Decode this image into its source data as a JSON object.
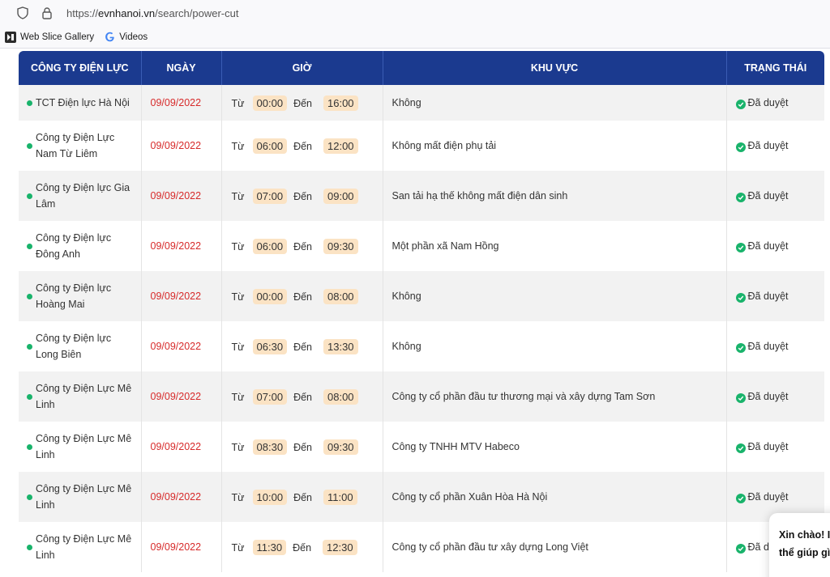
{
  "browser": {
    "url_prefix": "https://",
    "url_domain": "evnhanoi.vn",
    "url_path": "/search/power-cut"
  },
  "bookmarks": [
    {
      "label": "Web Slice Gallery",
      "icon": "web-slice-icon"
    },
    {
      "label": "Videos",
      "icon": "google-g-icon"
    }
  ],
  "table": {
    "headers": [
      "CÔNG TY ĐIỆN LỰC",
      "NGÀY",
      "GIỜ",
      "KHU VỰC",
      "TRẠNG THÁI"
    ],
    "from_label": "Từ",
    "to_label": "Đến",
    "rows": [
      {
        "company": "TCT Điện lực Hà Nội",
        "date": "09/09/2022",
        "from": "00:00",
        "to": "16:00",
        "area": "Không",
        "status": "Đã duyệt"
      },
      {
        "company": "Công ty Điện Lực Nam Từ Liêm",
        "date": "09/09/2022",
        "from": "06:00",
        "to": "12:00",
        "area": "Không mất điện phụ tải",
        "status": "Đã duyệt"
      },
      {
        "company": "Công ty Điện lực Gia Lâm",
        "date": "09/09/2022",
        "from": "07:00",
        "to": "09:00",
        "area": "San tải hạ thế không mất điện dân sinh",
        "status": "Đã duyệt"
      },
      {
        "company": "Công ty Điện lực Đông Anh",
        "date": "09/09/2022",
        "from": "06:00",
        "to": "09:30",
        "area": "Một phần xã Nam Hồng",
        "status": "Đã duyệt"
      },
      {
        "company": "Công ty Điện lực Hoàng Mai",
        "date": "09/09/2022",
        "from": "00:00",
        "to": "08:00",
        "area": "Không",
        "status": "Đã duyệt"
      },
      {
        "company": "Công ty Điện lực Long Biên",
        "date": "09/09/2022",
        "from": "06:30",
        "to": "13:30",
        "area": "Không",
        "status": "Đã duyệt"
      },
      {
        "company": "Công ty Điện Lực Mê Linh",
        "date": "09/09/2022",
        "from": "07:00",
        "to": "08:00",
        "area": "Công ty cổ phần đầu tư thương mại và xây dựng Tam Sơn",
        "status": "Đã duyệt"
      },
      {
        "company": "Công ty Điện Lực Mê Linh",
        "date": "09/09/2022",
        "from": "08:30",
        "to": "09:30",
        "area": "Công ty TNHH MTV Habeco",
        "status": "Đã duyệt"
      },
      {
        "company": "Công ty Điện Lực Mê Linh",
        "date": "09/09/2022",
        "from": "10:00",
        "to": "11:00",
        "area": "Công ty cổ phần Xuân Hòa Hà Nội",
        "status": "Đã duyệt"
      },
      {
        "company": "Công ty Điện Lực Mê Linh",
        "date": "09/09/2022",
        "from": "11:30",
        "to": "12:30",
        "area": "Công ty cổ phần đầu tư xây dựng Long Việt",
        "status": "Đã duyệt"
      }
    ]
  },
  "chat": {
    "line1": "Xin chào! I",
    "line2": "thể giúp gì"
  },
  "colors": {
    "header_bg": "#1b3a8f",
    "date_red": "#d72a2a",
    "status_green": "#19b36b",
    "time_pill": "#fbe3c4"
  }
}
